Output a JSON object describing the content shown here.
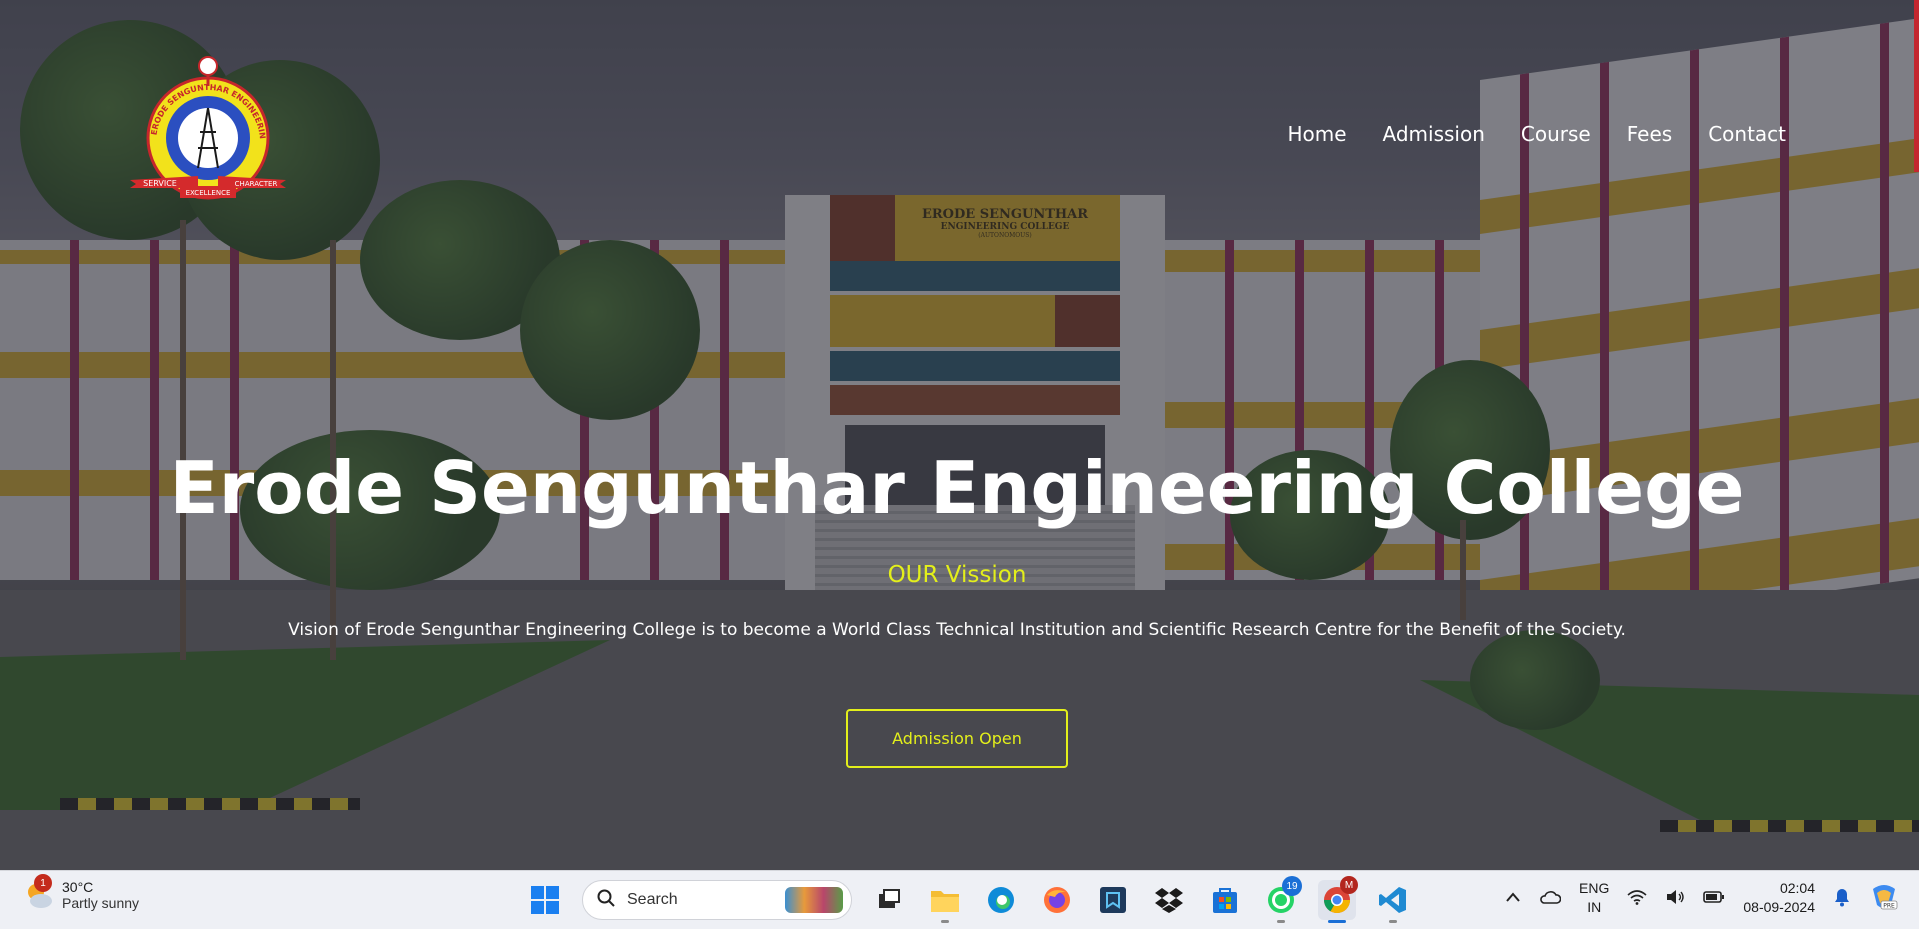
{
  "logo": {
    "ring_text": "ERODE SENGUNTHAR ENGINEERING COLLEGE",
    "ribbon_left": "SERVICE",
    "ribbon_right": "CHARACTER",
    "ribbon_bottom": "EXCELLENCE"
  },
  "nav": {
    "items": [
      "Home",
      "Admission",
      "Course",
      "Fees",
      "Contact"
    ]
  },
  "hero": {
    "building_sign_line1": "ERODE SENGUNTHAR",
    "building_sign_line2": "ENGINEERING COLLEGE",
    "building_sign_line3": "(AUTONOMOUS)",
    "title": "Erode Sengunthar Engineering College",
    "vision_heading": "OUR Vission",
    "vision_text": "Vision of Erode Sengunthar Engineering College is to become a World Class Technical Institution and Scientific Research Centre for the Benefit of the Society.",
    "cta_label": "Admission Open"
  },
  "colors": {
    "accent": "#e3ef1b",
    "overlay": "#262630",
    "scroll_accent": "#c3272f"
  },
  "taskbar": {
    "weather": {
      "temp": "30°C",
      "condition": "Partly sunny",
      "badge": "1"
    },
    "search_placeholder": "Search",
    "apps": [
      {
        "name": "windows-start-icon"
      },
      {
        "name": "task-view-icon"
      },
      {
        "name": "file-explorer-icon"
      },
      {
        "name": "edge-icon"
      },
      {
        "name": "firefox-icon"
      },
      {
        "name": "app-blue-icon"
      },
      {
        "name": "dropbox-icon"
      },
      {
        "name": "store-icon"
      },
      {
        "name": "whatsapp-icon",
        "badge": "19"
      },
      {
        "name": "chrome-icon",
        "badge": "M"
      },
      {
        "name": "vscode-icon"
      }
    ],
    "lang_line1": "ENG",
    "lang_line2": "IN",
    "time": "02:04",
    "date": "08-09-2024"
  }
}
